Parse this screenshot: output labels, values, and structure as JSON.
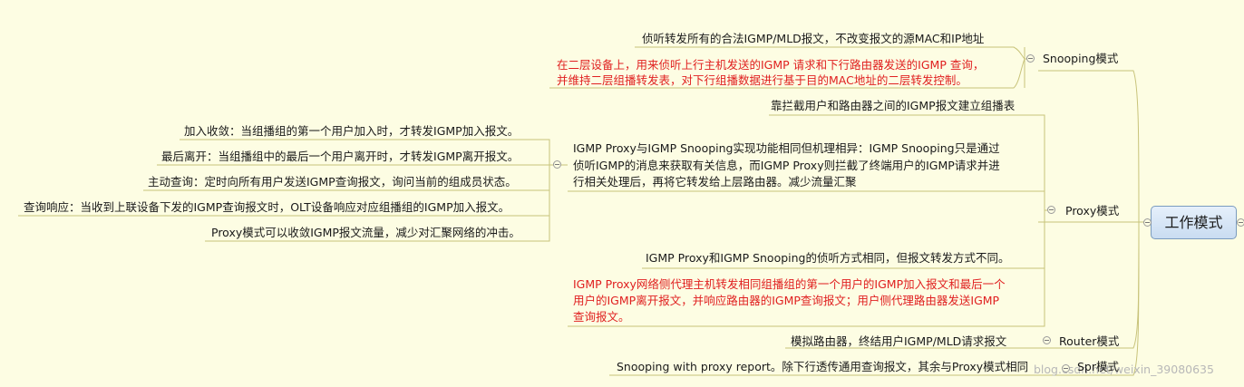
{
  "root": "工作模式",
  "branches": {
    "snooping": {
      "label": "Snooping模式",
      "items": [
        "侦听转发所有的合法IGMP/MLD报文，不改变报文的源MAC和IP地址",
        [
          "在二层设备上，用来侦听上行主机发送的IGMP 请求和下行路由器发送的IGMP 查询，",
          "并维持二层组播转发表，对下行组播数据进行基于目的MAC地址的二层转发控制。"
        ]
      ]
    },
    "proxy": {
      "label": "Proxy模式",
      "items": [
        "靠拦截用户和路由器之间的IGMP报文建立组播表",
        [
          "IGMP    Proxy与IGMP Snooping实现功能相同但机理相异：IGMP Snooping只是通过",
          "侦听IGMP的消息来获取有关信息，而IGMP Proxy则拦截了终端用户的IGMP请求并进",
          "行相关处理后，再将它转发给上层路由器。减少流量汇聚"
        ],
        "IGMP Proxy和IGMP Snooping的侦听方式相同，但报文转发方式不同。",
        [
          "IGMP Proxy网络侧代理主机转发相同组播组的第一个用户的IGMP加入报文和最后一个",
          "用户的IGMP离开报文，并响应路由器的IGMP查询报文；用户侧代理路由器发送IGMP",
          "查询报文。"
        ]
      ],
      "sub": [
        "加入收敛：当组播组的第一个用户加入时，才转发IGMP加入报文。",
        "最后离开：当组播组中的最后一个用户离开时，才转发IGMP离开报文。",
        "主动查询：定时向所有用户发送IGMP查询报文，询问当前的组成员状态。",
        "查询响应：当收到上联设备下发的IGMP查询报文时，OLT设备响应对应组播组的IGMP加入报文。",
        "Proxy模式可以收敛IGMP报文流量，减少对汇聚网络的冲击。"
      ]
    },
    "router": {
      "label": "Router模式",
      "items": [
        "模拟路由器，终结用户IGMP/MLD请求报文"
      ]
    },
    "spr": {
      "label": "Spr模式",
      "items": [
        "Snooping with proxy report。除下行透传通用查询报文，其余与Proxy模式相同"
      ]
    }
  },
  "watermark": "blog.csdn.net/weixin_39080635",
  "colors": {
    "line": "#c8c37a",
    "red_text": "#e02020",
    "root_border": "#7a9bbf"
  }
}
